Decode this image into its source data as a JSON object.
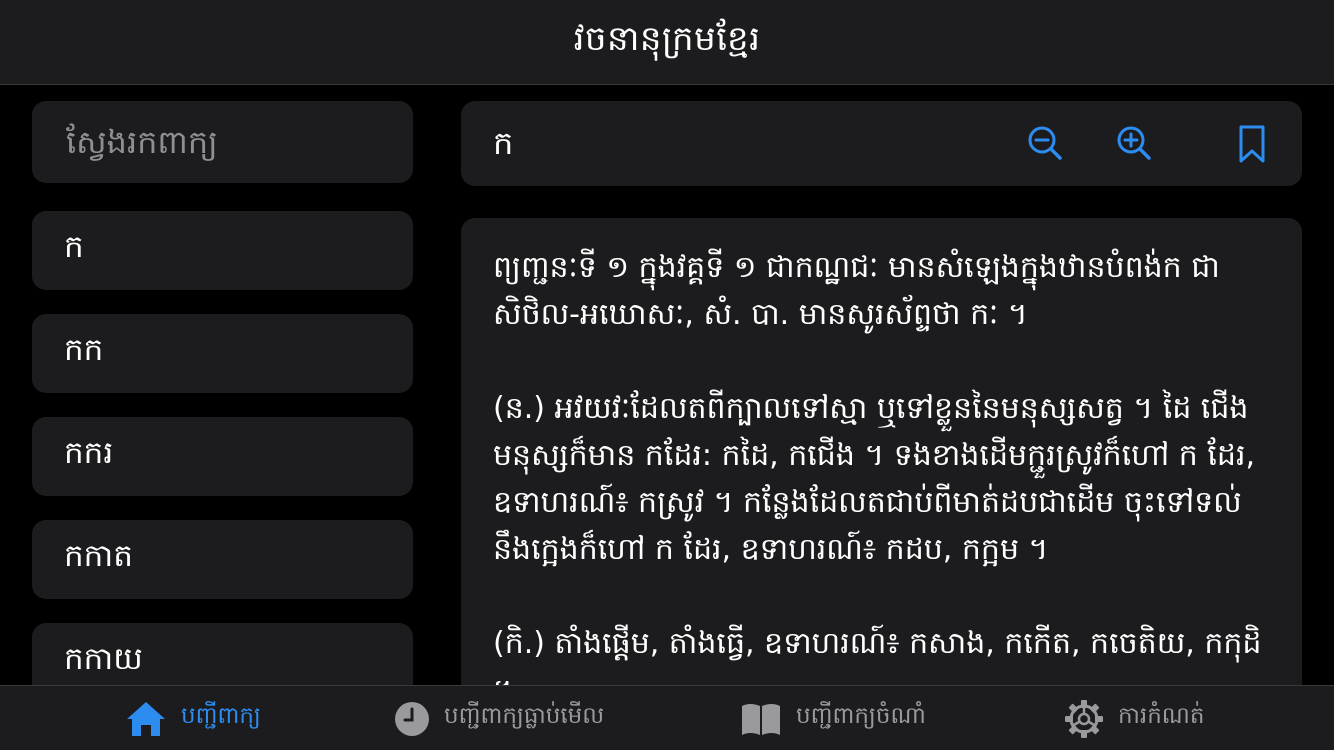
{
  "header": {
    "title": "វចនានុក្រមខ្មែរ"
  },
  "search": {
    "placeholder": "ស្វែងរកពាក្យ",
    "value": ""
  },
  "word_list": {
    "items": [
      "ក",
      "កក",
      "កករ",
      "កកាត",
      "កកាយ"
    ]
  },
  "toolbar": {
    "current_word": "ក",
    "zoom_out_icon": "zoom-out-icon",
    "zoom_in_icon": "zoom-in-icon",
    "bookmark_icon": "bookmark-icon"
  },
  "definition": {
    "paragraphs": [
      "ព្យញ្ជនៈទី ១ ក្នុងវគ្គទី ១ ជាកណ្ឋជៈ មានសំឡេងក្នុងឋានបំពង់ក ជាសិថិល-អឃោសៈ, សំ. បា. មានសូរស័ព្ទថា កៈ ។",
      "(ន.) អវយវៈដែលតពីក្បាលទៅស្មា ឬទៅខ្លួននៃមនុស្សសត្វ ។ ដៃ ជើងមនុស្សក៏មាន កដែរ: កដៃ, កជើង ។ ទងខាងដើមក្ជួរស្រូវក៏ហៅ ក ដែរ, ឧទាហរណ៍៖ កស្រូវ ។ កន្លែងដែលតជាប់ពីមាត់ដបជាដើម ចុះទៅទល់នឹងក្អេងក៏ហៅ ក ដែរ, ឧទាហរណ៍៖ កដប, កក្អម ។",
      "(កិ.) តាំងផ្ដើម, តាំងធ្វើ, ឧទាហរណ៍៖ កសាង, កកើត, កចេតិយ, កកុដិ ។"
    ]
  },
  "tabbar": {
    "tabs": [
      {
        "label": "បញ្ជីពាក្យ",
        "icon": "home-icon",
        "active": true
      },
      {
        "label": "បញ្ជីពាក្យធ្លាប់មើល",
        "icon": "clock-icon",
        "active": false
      },
      {
        "label": "បញ្ជីពាក្យចំណាំ",
        "icon": "book-icon",
        "active": false
      },
      {
        "label": "ការកំណត់",
        "icon": "gear-icon",
        "active": false
      }
    ]
  },
  "colors": {
    "accent": "#2d8cf0",
    "background": "#000000",
    "surface": "#1c1c1e",
    "inactive": "#9a9a9e"
  }
}
